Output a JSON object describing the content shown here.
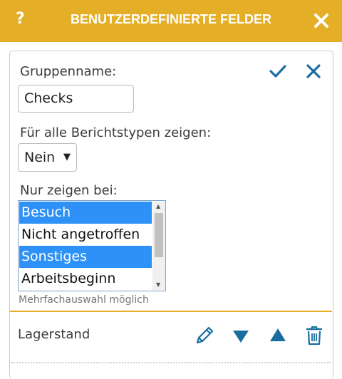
{
  "header": {
    "help_label": "?",
    "title": "BENUTZERDEFINIERTE FELDER"
  },
  "form": {
    "group_name_label": "Gruppenname:",
    "group_name_value": "Checks",
    "show_all_label": "Für alle Berichtstypen zeigen:",
    "show_all_value": "Nein",
    "only_show_label": "Nur zeigen bei:",
    "options": [
      {
        "label": "Besuch",
        "selected": true
      },
      {
        "label": "Nicht angetroffen",
        "selected": false
      },
      {
        "label": "Sonstiges",
        "selected": true
      },
      {
        "label": "Arbeitsbeginn",
        "selected": false
      }
    ],
    "multi_hint": "Mehrfachauswahl möglich"
  },
  "field_row": {
    "label": "Lagerstand"
  },
  "colors": {
    "accent": "#e5ae27",
    "icon_blue": "#1a6e9f",
    "selection": "#2d91f7"
  }
}
